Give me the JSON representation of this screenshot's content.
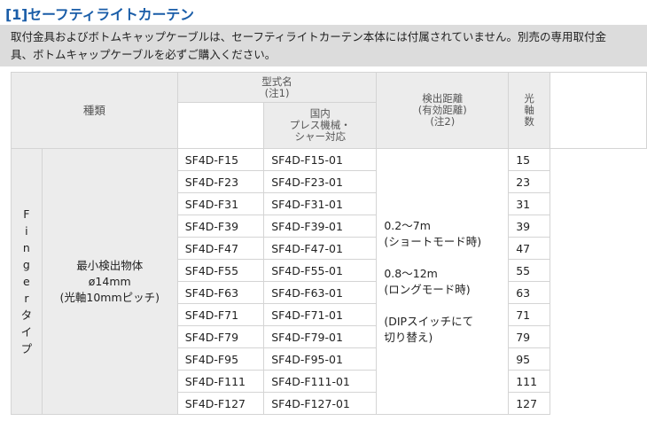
{
  "section_title": "[1]セーフティライトカーテン",
  "note_lines": [
    "取付金具およびボトムキャップケーブルは、セーフティライトカーテン本体には付属されていません。別売の専用取付金",
    "具、ボトムキャップケーブルを必ずご購入ください。"
  ],
  "table": {
    "headers": {
      "type": "種類",
      "model": "型式名\n(注1)",
      "model_domestic": "国内\nプレス機械・\nシャー対応",
      "distance": "検出距離\n(有効距離)\n(注2)",
      "axes": "光\n軸\n数"
    },
    "category": "F\ni\nn\ng\ne\nr\nタ\nイ\nプ",
    "description": "最小検出物体\nø14mm\n(光軸10mmピッチ)",
    "distance_text": "0.2～7m\n(ショートモード時)\n\n0.8～12m\n(ロングモード時)\n\n(DIPスイッチにて\n切り替え)",
    "rows": [
      {
        "model": "SF4D-F15",
        "domestic": "SF4D-F15-01",
        "axes": "15"
      },
      {
        "model": "SF4D-F23",
        "domestic": "SF4D-F23-01",
        "axes": "23"
      },
      {
        "model": "SF4D-F31",
        "domestic": "SF4D-F31-01",
        "axes": "31"
      },
      {
        "model": "SF4D-F39",
        "domestic": "SF4D-F39-01",
        "axes": "39"
      },
      {
        "model": "SF4D-F47",
        "domestic": "SF4D-F47-01",
        "axes": "47"
      },
      {
        "model": "SF4D-F55",
        "domestic": "SF4D-F55-01",
        "axes": "55"
      },
      {
        "model": "SF4D-F63",
        "domestic": "SF4D-F63-01",
        "axes": "63"
      },
      {
        "model": "SF4D-F71",
        "domestic": "SF4D-F71-01",
        "axes": "71"
      },
      {
        "model": "SF4D-F79",
        "domestic": "SF4D-F79-01",
        "axes": "79"
      },
      {
        "model": "SF4D-F95",
        "domestic": "SF4D-F95-01",
        "axes": "95"
      },
      {
        "model": "SF4D-F111",
        "domestic": "SF4D-F111-01",
        "axes": "111"
      },
      {
        "model": "SF4D-F127",
        "domestic": "SF4D-F127-01",
        "axes": "127"
      }
    ]
  },
  "colors": {
    "title": "#1a5da8",
    "note_bg": "#dcdcdc",
    "header_bg": "#ececec",
    "border": "#d4d4d4"
  }
}
